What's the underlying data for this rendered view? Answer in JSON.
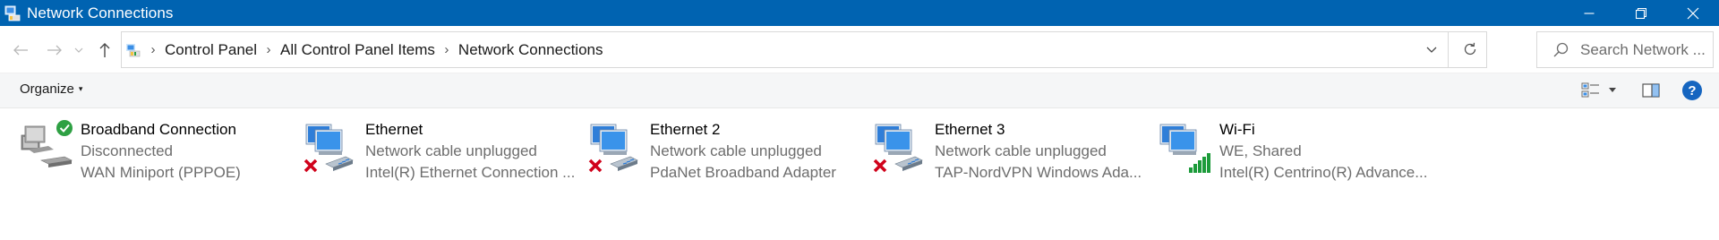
{
  "window": {
    "title": "Network Connections",
    "buttons": [
      "minimize",
      "restore",
      "close"
    ]
  },
  "nav": {
    "back_icon": "back-arrow-icon",
    "forward_icon": "forward-arrow-icon",
    "recent_icon": "recent-locations-chevron-icon",
    "up_icon": "up-arrow-icon"
  },
  "address": {
    "breadcrumbs": [
      "Control Panel",
      "All Control Panel Items",
      "Network Connections"
    ],
    "separator": "›"
  },
  "search": {
    "placeholder": "Search Network ..."
  },
  "command_bar": {
    "organize_label": "Organize",
    "organize_caret": "▾"
  },
  "connections": [
    {
      "name": "Broadband Connection",
      "status": "Disconnected",
      "device": "WAN Miniport (PPPOE)",
      "icon": "dialup-connection-icon",
      "badge": "check-badge"
    },
    {
      "name": "Ethernet",
      "status": "Network cable unplugged",
      "device": "Intel(R) Ethernet Connection ...",
      "icon": "ethernet-adapter-icon",
      "badge": "red-x-badge"
    },
    {
      "name": "Ethernet 2",
      "status": "Network cable unplugged",
      "device": "PdaNet Broadband Adapter",
      "icon": "ethernet-adapter-icon",
      "badge": "red-x-badge"
    },
    {
      "name": "Ethernet 3",
      "status": "Network cable unplugged",
      "device": "TAP-NordVPN Windows Ada...",
      "icon": "ethernet-adapter-icon",
      "badge": "red-x-badge"
    },
    {
      "name": "Wi-Fi",
      "status": "WE, Shared",
      "device": "Intel(R) Centrino(R) Advance...",
      "icon": "wifi-adapter-icon",
      "badge": "signal-bars-badge"
    }
  ],
  "colors": {
    "titlebar": "#0063b1",
    "error": "#d0021b",
    "success": "#2ea043",
    "signal": "#1c9b3a"
  }
}
